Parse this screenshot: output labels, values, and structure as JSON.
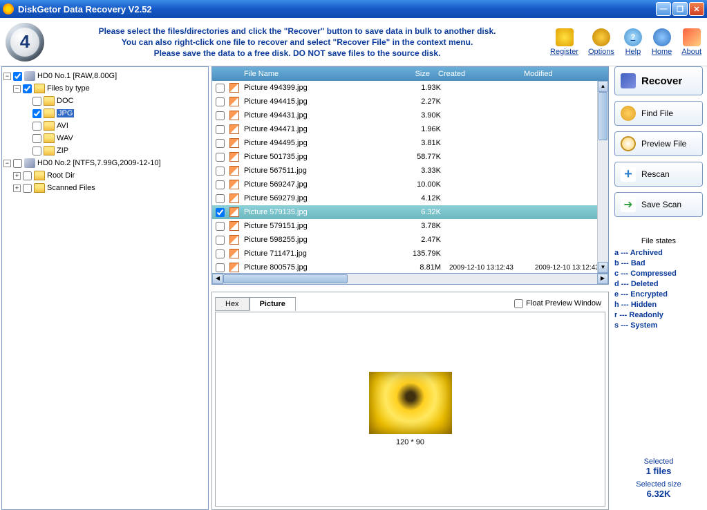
{
  "title": "DiskGetor Data Recovery V2.52",
  "step_number": "4",
  "instructions": {
    "line1": "Please select the files/directories and click the \"Recover\" button to save data in bulk to another disk.",
    "line2": "You can also right-click one file to recover and select \"Recover File\" in the context menu.",
    "line3": "Please save the data to a free disk. DO NOT save files to the source disk."
  },
  "toolbar": {
    "register": "Register",
    "options": "Options",
    "help": "Help",
    "home": "Home",
    "about": "About"
  },
  "tree": {
    "hd1": "HD0 No.1 [RAW,8.00G]",
    "files_by_type": "Files by type",
    "types": {
      "doc": "DOC",
      "jpg": "JPG",
      "avi": "AVI",
      "wav": "WAV",
      "zip": "ZIP"
    },
    "hd2": "HD0 No.2 [NTFS,7.99G,2009-12-10]",
    "root_dir": "Root Dir",
    "scanned_files": "Scanned Files"
  },
  "columns": {
    "name": "File Name",
    "size": "Size",
    "created": "Created",
    "modified": "Modified"
  },
  "files": [
    {
      "name": "Picture 494399.jpg",
      "size": "1.93K",
      "created": "",
      "modified": "",
      "checked": false,
      "selected": false
    },
    {
      "name": "Picture 494415.jpg",
      "size": "2.27K",
      "created": "",
      "modified": "",
      "checked": false,
      "selected": false
    },
    {
      "name": "Picture 494431.jpg",
      "size": "3.90K",
      "created": "",
      "modified": "",
      "checked": false,
      "selected": false
    },
    {
      "name": "Picture 494471.jpg",
      "size": "1.96K",
      "created": "",
      "modified": "",
      "checked": false,
      "selected": false
    },
    {
      "name": "Picture 494495.jpg",
      "size": "3.81K",
      "created": "",
      "modified": "",
      "checked": false,
      "selected": false
    },
    {
      "name": "Picture 501735.jpg",
      "size": "58.77K",
      "created": "",
      "modified": "",
      "checked": false,
      "selected": false
    },
    {
      "name": "Picture 567511.jpg",
      "size": "3.33K",
      "created": "",
      "modified": "",
      "checked": false,
      "selected": false
    },
    {
      "name": "Picture 569247.jpg",
      "size": "10.00K",
      "created": "",
      "modified": "",
      "checked": false,
      "selected": false
    },
    {
      "name": "Picture 569279.jpg",
      "size": "4.12K",
      "created": "",
      "modified": "",
      "checked": false,
      "selected": false
    },
    {
      "name": "Picture 579135.jpg",
      "size": "6.32K",
      "created": "",
      "modified": "",
      "checked": true,
      "selected": true
    },
    {
      "name": "Picture 579151.jpg",
      "size": "3.78K",
      "created": "",
      "modified": "",
      "checked": false,
      "selected": false
    },
    {
      "name": "Picture 598255.jpg",
      "size": "2.47K",
      "created": "",
      "modified": "",
      "checked": false,
      "selected": false
    },
    {
      "name": "Picture 711471.jpg",
      "size": "135.79K",
      "created": "",
      "modified": "",
      "checked": false,
      "selected": false
    },
    {
      "name": "Picture 800575.jpg",
      "size": "8.81M",
      "created": "2009-12-10 13:12:43",
      "modified": "2009-12-10 13:12:43",
      "checked": false,
      "selected": false
    }
  ],
  "preview": {
    "tab_hex": "Hex",
    "tab_picture": "Picture",
    "float_label": "Float Preview Window",
    "dimensions": "120 * 90"
  },
  "actions": {
    "recover": "Recover",
    "find": "Find File",
    "preview": "Preview File",
    "rescan": "Rescan",
    "save_scan": "Save Scan"
  },
  "file_states": {
    "title": "File states",
    "a": "a --- Archived",
    "b": "b --- Bad",
    "c": "c --- Compressed",
    "d": "d --- Deleted",
    "e": "e --- Encrypted",
    "h": "h --- Hidden",
    "r": "r --- Readonly",
    "s": "s --- System"
  },
  "selection": {
    "label_count": "Selected",
    "count": "1 files",
    "label_size": "Selected size",
    "size": "6.32K"
  }
}
